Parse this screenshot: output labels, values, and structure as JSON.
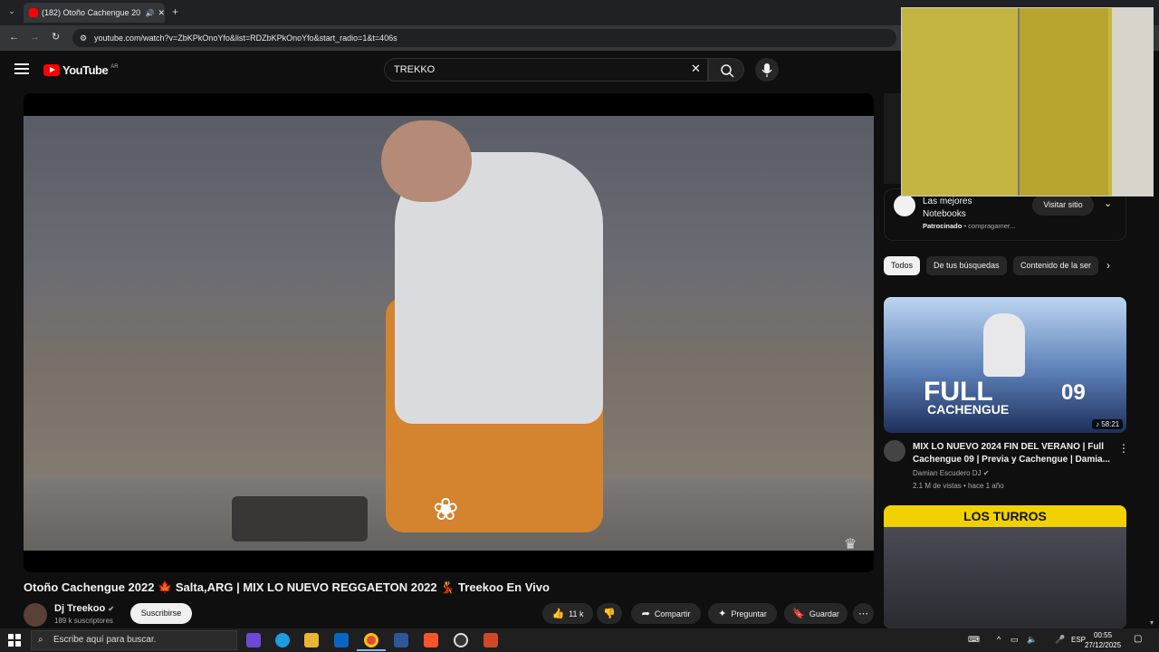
{
  "browser": {
    "tab_title": "(182) Otoño Cachengue 20",
    "url": "youtube.com/watch?v=ZbKPkOnoYfo&list=RDZbKPkOnoYfo&start_radio=1&t=406s"
  },
  "header": {
    "logo_text": "YouTube",
    "region": "AR",
    "search_value": "TREKKO"
  },
  "video": {
    "title": "Otoño Cachengue 2022 🍁 Salta,ARG | MIX LO NUEVO REGGAETON 2022 💃 Treekoo En Vivo",
    "channel": "Dj Treekoo",
    "subscribers": "189 k suscriptores",
    "subscribe_label": "Suscribirse",
    "likes": "11 k",
    "share_label": "Compartir",
    "ask_label": "Preguntar",
    "save_label": "Guardar"
  },
  "ad": {
    "title": "Las mejores Notebooks",
    "sponsored": "Patrocinado",
    "domain": "compragamer...",
    "visit_label": "Visitar sitio"
  },
  "chips": [
    "Todos",
    "De tus búsquedas",
    "Contenido de la ser"
  ],
  "related": [
    {
      "thumb_text_big": "FULL",
      "thumb_text_num": "09",
      "thumb_text_sub": "CACHENGUE",
      "duration": "58:21",
      "title": "MIX LO NUEVO 2024 FIN DEL VERANO | Full Cachengue 09 | Previa y Cachengue | Damia...",
      "channel": "Damian Escudero DJ",
      "meta": "2.1 M de vistas • hace 1 año"
    },
    {
      "thumb_title": "LOS TURROS"
    }
  ],
  "taskbar": {
    "search_placeholder": "Escribe aquí para buscar.",
    "lang": "ESP",
    "time": "00:55",
    "date": "27/12/2025"
  }
}
